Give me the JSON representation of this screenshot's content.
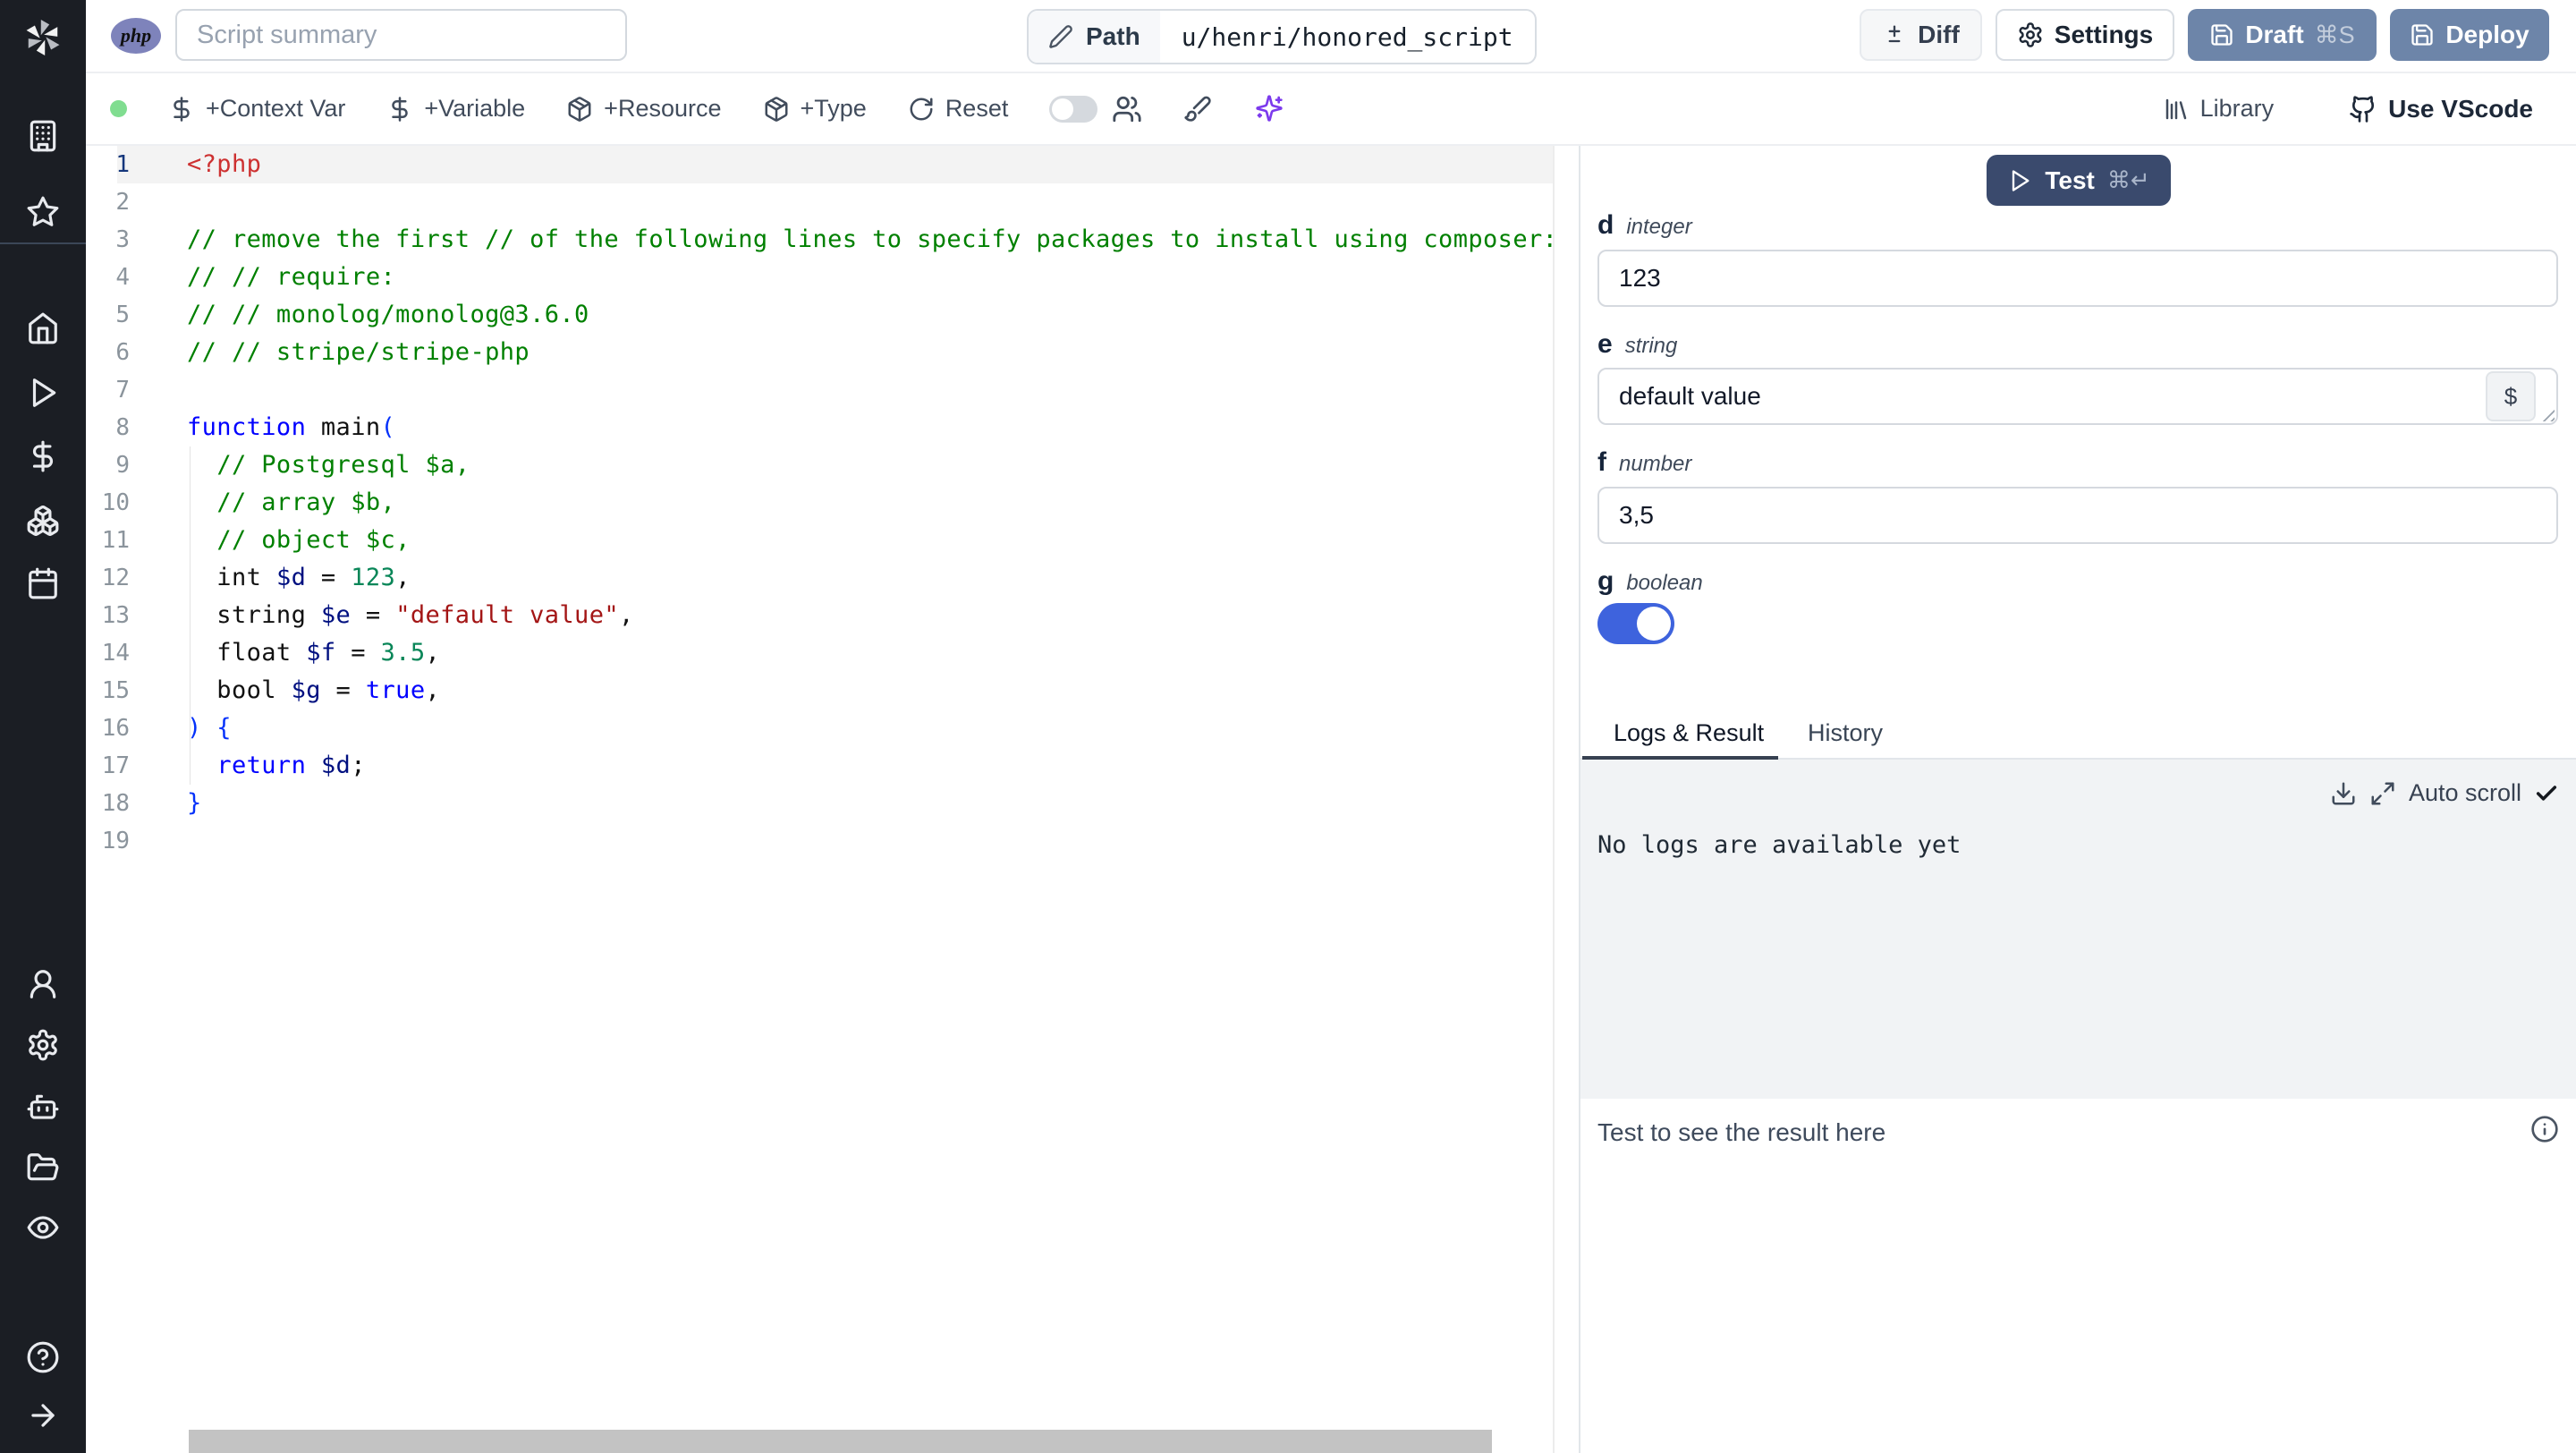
{
  "topbar": {
    "lang_badge": "php",
    "summary_placeholder": "Script summary",
    "path_label": "Path",
    "path_value": "u/henri/honored_script",
    "diff_label": "Diff",
    "settings_label": "Settings",
    "draft_label": "Draft",
    "draft_kbd": "⌘S",
    "deploy_label": "Deploy"
  },
  "toolbar": {
    "context_var_label": "+Context Var",
    "variable_label": "+Variable",
    "resource_label": "+Resource",
    "type_label": "+Type",
    "reset_label": "Reset",
    "library_label": "Library",
    "vscode_label": "Use VScode"
  },
  "sidebar": {
    "icons": [
      "building-icon",
      "star-icon",
      "home-icon",
      "play-icon",
      "dollar-icon",
      "boxes-icon",
      "calendar-icon",
      "user-icon",
      "gear-icon",
      "robot-icon",
      "folder-icon",
      "eye-icon",
      "help-icon",
      "arrow-right-icon"
    ]
  },
  "editor": {
    "language": "php",
    "lines": [
      {
        "n": 1,
        "tokens": [
          [
            "<?php",
            "tag"
          ]
        ]
      },
      {
        "n": 2,
        "tokens": []
      },
      {
        "n": 3,
        "tokens": [
          [
            "// remove the first // of the following lines to specify packages to install using composer:",
            "com"
          ]
        ]
      },
      {
        "n": 4,
        "tokens": [
          [
            "// // require:",
            "com"
          ]
        ]
      },
      {
        "n": 5,
        "tokens": [
          [
            "// // monolog/monolog@3.6.0",
            "com"
          ]
        ]
      },
      {
        "n": 6,
        "tokens": [
          [
            "// // stripe/stripe-php",
            "com"
          ]
        ]
      },
      {
        "n": 7,
        "tokens": []
      },
      {
        "n": 8,
        "tokens": [
          [
            "function",
            "kw"
          ],
          [
            " main",
            "pl"
          ],
          [
            "(",
            "par"
          ]
        ]
      },
      {
        "n": 9,
        "tokens": [
          [
            "  ",
            "pl"
          ],
          [
            "// Postgresql $a,",
            "com"
          ]
        ]
      },
      {
        "n": 10,
        "tokens": [
          [
            "  ",
            "pl"
          ],
          [
            "// array $b,",
            "com"
          ]
        ]
      },
      {
        "n": 11,
        "tokens": [
          [
            "  ",
            "pl"
          ],
          [
            "// object $c,",
            "com"
          ]
        ]
      },
      {
        "n": 12,
        "tokens": [
          [
            "  int ",
            "pl"
          ],
          [
            "$d",
            "var"
          ],
          [
            " = ",
            "pl"
          ],
          [
            "123",
            "num"
          ],
          [
            ",",
            "pl"
          ]
        ]
      },
      {
        "n": 13,
        "tokens": [
          [
            "  string ",
            "pl"
          ],
          [
            "$e",
            "var"
          ],
          [
            " = ",
            "pl"
          ],
          [
            "\"default value\"",
            "str"
          ],
          [
            ",",
            "pl"
          ]
        ]
      },
      {
        "n": 14,
        "tokens": [
          [
            "  float ",
            "pl"
          ],
          [
            "$f",
            "var"
          ],
          [
            " = ",
            "pl"
          ],
          [
            "3.5",
            "num"
          ],
          [
            ",",
            "pl"
          ]
        ]
      },
      {
        "n": 15,
        "tokens": [
          [
            "  bool ",
            "pl"
          ],
          [
            "$g",
            "var"
          ],
          [
            " = ",
            "pl"
          ],
          [
            "true",
            "kw"
          ],
          [
            ",",
            "pl"
          ]
        ]
      },
      {
        "n": 16,
        "tokens": [
          [
            ") {",
            "par"
          ]
        ]
      },
      {
        "n": 17,
        "tokens": [
          [
            "  ",
            "pl"
          ],
          [
            "return",
            "kw"
          ],
          [
            " ",
            "pl"
          ],
          [
            "$d",
            "var"
          ],
          [
            ";",
            "pl"
          ]
        ]
      },
      {
        "n": 18,
        "tokens": [
          [
            "}",
            "par"
          ]
        ]
      },
      {
        "n": 19,
        "tokens": []
      }
    ]
  },
  "panel": {
    "test_label": "Test",
    "test_kbd": "⌘↵",
    "fields": [
      {
        "name": "d",
        "type": "integer",
        "value": "123"
      },
      {
        "name": "e",
        "type": "string",
        "value": "default value"
      },
      {
        "name": "f",
        "type": "number",
        "value": "3,5"
      },
      {
        "name": "g",
        "type": "boolean",
        "value": true
      }
    ],
    "dollar_button": "$",
    "tabs": [
      "Logs & Result",
      "History"
    ],
    "auto_scroll_label": "Auto scroll",
    "no_logs_text": "No logs are available yet",
    "result_placeholder": "Test to see the result here"
  },
  "colors": {
    "accent_primary": "#6d85a9",
    "test_button": "#3a4a6d",
    "toggle_on": "#3e63dd",
    "status_dot": "#80dd90",
    "sparkles": "#7c3aed",
    "sidebar_bg": "#1b1e24"
  }
}
